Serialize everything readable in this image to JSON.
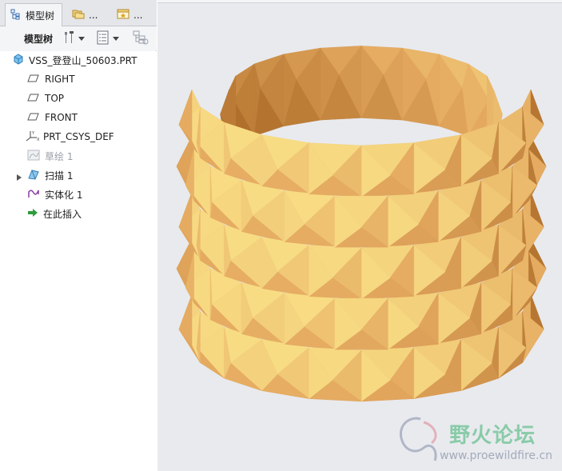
{
  "tabs": [
    {
      "label": "模型树",
      "icon": "model-tree-icon",
      "active": true
    },
    {
      "label": "...",
      "icon": "folder-browser-icon",
      "active": false
    },
    {
      "label": "...",
      "icon": "favorites-icon",
      "active": false
    }
  ],
  "toolbar": {
    "title": "模型树",
    "settings_icon": "tools-icon",
    "show_icon": "list-icon",
    "filter_icon": "filter-icon"
  },
  "tree": {
    "root": {
      "label": "VSS_登登山_50603.PRT",
      "icon": "part-icon"
    },
    "items": [
      {
        "label": "RIGHT",
        "icon": "datum-plane-icon",
        "dim": false,
        "expandable": false
      },
      {
        "label": "TOP",
        "icon": "datum-plane-icon",
        "dim": false,
        "expandable": false
      },
      {
        "label": "FRONT",
        "icon": "datum-plane-icon",
        "dim": false,
        "expandable": false
      },
      {
        "label": "PRT_CSYS_DEF",
        "icon": "coordinate-system-icon",
        "dim": false,
        "expandable": false
      },
      {
        "label": "草绘 1",
        "icon": "sketch-icon",
        "dim": true,
        "expandable": false
      },
      {
        "label": "扫描 1",
        "icon": "sweep-icon",
        "dim": false,
        "expandable": true
      },
      {
        "label": "实体化 1",
        "icon": "solidify-icon",
        "dim": false,
        "expandable": false
      },
      {
        "label": "在此插入",
        "icon": "insert-here-arrow-icon",
        "dim": false,
        "expandable": false
      }
    ]
  },
  "watermark": {
    "title": "野火论坛",
    "url": "www.proewildfire.cn"
  },
  "colors": {
    "panel_bg": "#f4f5f7",
    "view_bg": "#e8eaee",
    "model_dark": "#b0702c",
    "model_mid": "#e3a75e",
    "model_light": "#f8dc84"
  }
}
